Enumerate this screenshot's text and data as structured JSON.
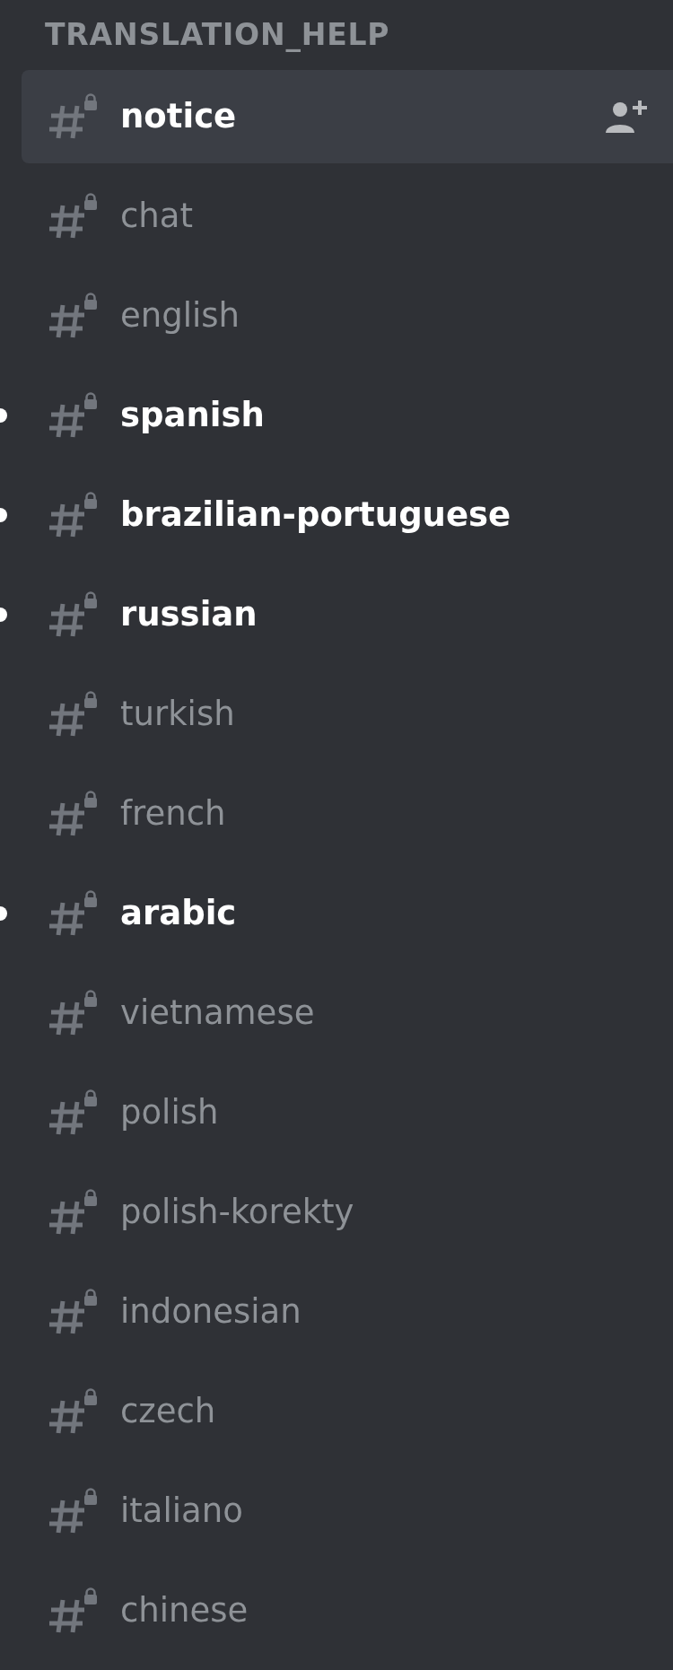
{
  "category": {
    "title": "TRANSLATION_HELP"
  },
  "channels": [
    {
      "name": "notice",
      "selected": true,
      "unread": false
    },
    {
      "name": "chat",
      "selected": false,
      "unread": false
    },
    {
      "name": "english",
      "selected": false,
      "unread": false
    },
    {
      "name": "spanish",
      "selected": false,
      "unread": true
    },
    {
      "name": "brazilian-portuguese",
      "selected": false,
      "unread": true
    },
    {
      "name": "russian",
      "selected": false,
      "unread": true
    },
    {
      "name": "turkish",
      "selected": false,
      "unread": false
    },
    {
      "name": "french",
      "selected": false,
      "unread": false
    },
    {
      "name": "arabic",
      "selected": false,
      "unread": true
    },
    {
      "name": "vietnamese",
      "selected": false,
      "unread": false
    },
    {
      "name": "polish",
      "selected": false,
      "unread": false
    },
    {
      "name": "polish-korekty",
      "selected": false,
      "unread": false
    },
    {
      "name": "indonesian",
      "selected": false,
      "unread": false
    },
    {
      "name": "czech",
      "selected": false,
      "unread": false
    },
    {
      "name": "italiano",
      "selected": false,
      "unread": false
    },
    {
      "name": "chinese",
      "selected": false,
      "unread": false
    }
  ]
}
